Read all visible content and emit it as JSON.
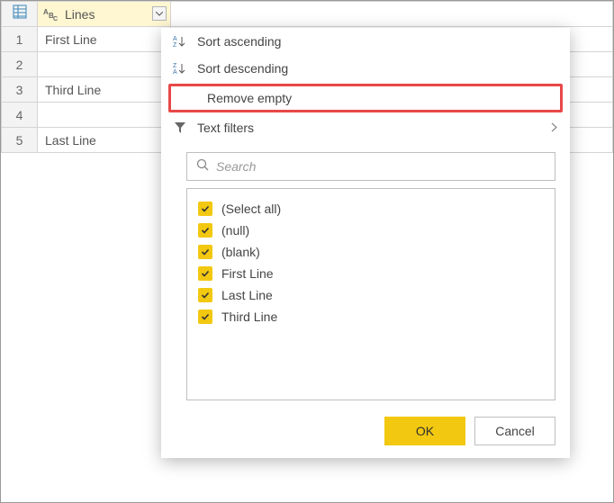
{
  "column": {
    "name": "Lines",
    "type_label": "ABC"
  },
  "rows": {
    "r1": {
      "num": "1",
      "value": "First Line"
    },
    "r2": {
      "num": "2",
      "value": ""
    },
    "r3": {
      "num": "3",
      "value": "Third Line"
    },
    "r4": {
      "num": "4",
      "value": ""
    },
    "r5": {
      "num": "5",
      "value": "Last Line"
    }
  },
  "menu": {
    "sort_asc": "Sort ascending",
    "sort_desc": "Sort descending",
    "remove_empty": "Remove empty",
    "text_filters": "Text filters"
  },
  "search": {
    "placeholder": "Search"
  },
  "values": {
    "select_all": "(Select all)",
    "null": "(null)",
    "blank": "(blank)",
    "first_line": "First Line",
    "last_line": "Last Line",
    "third_line": "Third Line"
  },
  "buttons": {
    "ok": "OK",
    "cancel": "Cancel"
  }
}
